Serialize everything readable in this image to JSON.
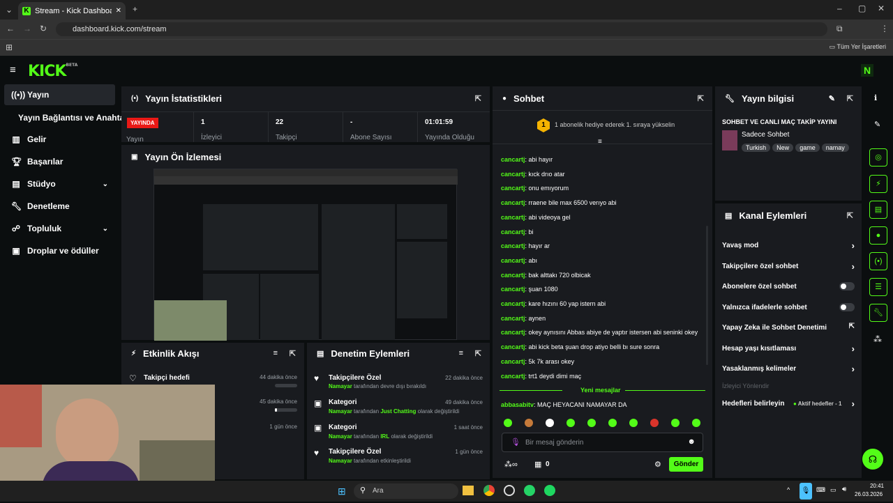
{
  "browser": {
    "tab_title": "Stream - Kick Dashboard",
    "url": "dashboard.kick.com/stream",
    "bookmarks_label": "Tüm Yer İşaretleri",
    "profile_initial": "O"
  },
  "app": {
    "logo": "KICK",
    "logo_badge": "BETA",
    "user_initial": "N"
  },
  "nav": {
    "items": [
      {
        "label": "Yayın"
      },
      {
        "label": "Yayın Bağlantısı ve Anahtarı"
      },
      {
        "label": "Gelir"
      },
      {
        "label": "Başarılar"
      },
      {
        "label": "Stüdyo"
      },
      {
        "label": "Denetleme"
      },
      {
        "label": "Topluluk"
      },
      {
        "label": "Droplar ve ödüller"
      }
    ]
  },
  "stats": {
    "title": "Yayın İstatistikleri",
    "live_badge": "YAYINDA",
    "cols": [
      {
        "value": "",
        "label": "Yayın"
      },
      {
        "value": "1",
        "label": "İzleyici"
      },
      {
        "value": "22",
        "label": "Takipçi"
      },
      {
        "value": "-",
        "label": "Abone Sayısı"
      },
      {
        "value": "01:01:59",
        "label": "Yayında Olduğu"
      }
    ]
  },
  "preview": {
    "title": "Yayın Ön İzlemesi"
  },
  "activity": {
    "title": "Etkinlik Akışı",
    "items": [
      {
        "title": "Takipçi hedefi",
        "time": "44 dakika önce",
        "progress": 0
      },
      {
        "title": "",
        "time": "45 dakika önce",
        "progress": 0.1
      },
      {
        "title": "",
        "time": "1 gün önce",
        "progress": null
      }
    ]
  },
  "moderation": {
    "title": "Denetim Eylemleri",
    "items": [
      {
        "title": "Takipçilere Özel",
        "time": "22 dakika önce",
        "user": "Namayar",
        "pre": "tarafından devre dışı bırakıldı",
        "highlight": "",
        "post": ""
      },
      {
        "title": "Kategori",
        "time": "49 dakika önce",
        "user": "Namayar",
        "pre": "tarafından",
        "highlight": "Just Chatting",
        "post": "olarak değiştirildi"
      },
      {
        "title": "Kategori",
        "time": "1 saat önce",
        "user": "Namayar",
        "pre": "tarafından",
        "highlight": "IRL",
        "post": "olarak değiştirildi"
      },
      {
        "title": "Takipçilere Özel",
        "time": "1 gün önce",
        "user": "Namayar",
        "pre": "tarafından etkinleştirildi",
        "highlight": "",
        "post": ""
      }
    ]
  },
  "chat": {
    "title": "Sohbet",
    "gift_text": "1 abonelik hediye ederek 1. sıraya yükselin",
    "gift_rank": "1",
    "messages": [
      {
        "user": "cancartj",
        "text": "abi hayır"
      },
      {
        "user": "cancartj",
        "text": "kıck drıo atar"
      },
      {
        "user": "cancartj",
        "text": "onu emıyorum"
      },
      {
        "user": "cancartj",
        "text": "rraene bile max 6500 verıyo abi"
      },
      {
        "user": "cancartj",
        "text": "abi videoya gel"
      },
      {
        "user": "cancartj",
        "text": "bi"
      },
      {
        "user": "cancartj",
        "text": "hayır ar"
      },
      {
        "user": "cancartj",
        "text": "abı"
      },
      {
        "user": "cancartj",
        "text": "bak alttakı 720 olbicak"
      },
      {
        "user": "cancartj",
        "text": "şuan 1080"
      },
      {
        "user": "cancartj",
        "text": "kare hızını 60 yap istern abi"
      },
      {
        "user": "cancartj",
        "text": "aynen"
      },
      {
        "user": "cancartj",
        "text": "okey aynısını Abbas abiye de yaptır istersen abi seninki okey"
      },
      {
        "user": "cancartj",
        "text": "abi kick beta şuan drop atiyo belli bı sure sonra"
      },
      {
        "user": "cancartj",
        "text": "5k 7k arası okey"
      },
      {
        "user": "cancartj",
        "text": "trt1 deydi dimi maç"
      }
    ],
    "new_messages": "Yeni mesajlar",
    "last_msg": {
      "user": "abbasabitv",
      "text": "MAÇ HEYACANI NAMAYAR DA"
    },
    "input_placeholder": "Bir mesaj gönderin",
    "points": "0",
    "send": "Gönder"
  },
  "info": {
    "title": "Yayın bilgisi",
    "stream_title": "SOHBET VE CANLI MAÇ TAKİP YAYINI",
    "category": "Sadece Sohbet",
    "tags": [
      "Turkish",
      "New",
      "game",
      "namay"
    ]
  },
  "channel": {
    "title": "Kanal Eylemleri",
    "items": [
      {
        "label": "Yavaş mod",
        "ctl": "chev"
      },
      {
        "label": "Takipçilere özel sohbet",
        "ctl": "chev"
      },
      {
        "label": "Abonelere özel sohbet",
        "ctl": "toggle"
      },
      {
        "label": "Yalnızca ifadelerle sohbet",
        "ctl": "toggle"
      },
      {
        "label": "Yapay Zeka ile Sohbet Denetimi",
        "ctl": "ext"
      },
      {
        "label": "Hesap yaşı kısıtlaması",
        "ctl": "chev"
      },
      {
        "label": "Yasaklanmış kelimeler",
        "ctl": "chev"
      }
    ],
    "disabled": "İzleyici Yönlendir",
    "goals_label": "Hedefleri belirleyin",
    "goals_status": "Aktif hedefler - 1"
  },
  "taskbar": {
    "search": "Ara",
    "time": "20:41",
    "date": "26.03.2026"
  },
  "colors": {
    "accent": "#53fc18",
    "live": "#e91916",
    "card": "#191b1f",
    "bg": "#0b0e0f"
  }
}
